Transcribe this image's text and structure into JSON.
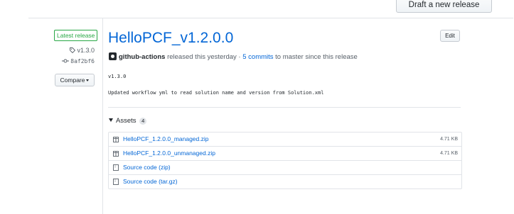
{
  "header": {
    "draft_button": "Draft a new release"
  },
  "sidebar": {
    "latest_badge": "Latest release",
    "tag": "v1.3.0",
    "commit": "8af2bf6",
    "compare_button": "Compare"
  },
  "release": {
    "title": "HelloPCF_v1.2.0.0",
    "edit_button": "Edit",
    "author": "github-actions",
    "released_text": "released this yesterday ·",
    "commits_link": "5 commits",
    "since_text": "to master since this release",
    "version_line": "v1.3.0",
    "description": "Updated workflow yml to read solution name and version from Solution.xml"
  },
  "assets": {
    "label": "Assets",
    "count": "4",
    "items": [
      {
        "name": "HelloPCF_1.2.0.0_managed.zip",
        "size": "4.71 KB",
        "icon": "package-icon"
      },
      {
        "name": "HelloPCF_1.2.0.0_unmanaged.zip",
        "size": "4.71 KB",
        "icon": "package-icon"
      },
      {
        "name": "Source code",
        "suffix": "(zip)",
        "size": "",
        "icon": "file-zip-icon"
      },
      {
        "name": "Source code",
        "suffix": "(tar.gz)",
        "size": "",
        "icon": "file-zip-icon"
      }
    ]
  },
  "colors": {
    "link": "#0366d6",
    "badge_green": "#28a745",
    "muted": "#586069",
    "border": "#e1e4e8"
  }
}
